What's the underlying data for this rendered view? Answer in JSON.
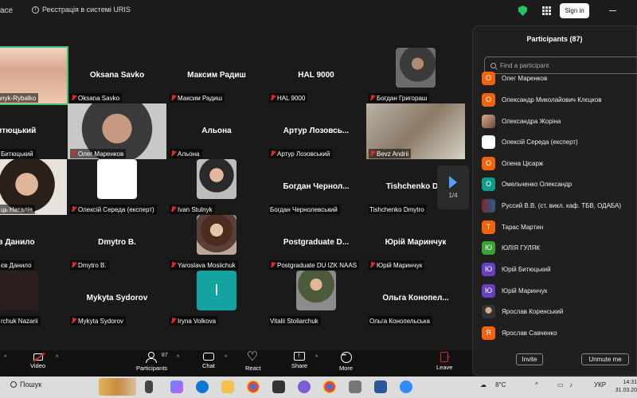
{
  "topbar": {
    "app_name": "ace",
    "registration": "Реєстрація в системі URIS",
    "sign_in": "Sign in"
  },
  "gallery": {
    "tiles": [
      {
        "name": "",
        "label": "a Kalashnyk-Rybalko"
      },
      {
        "name": "Oksana Savko",
        "label": "Oksana Savko"
      },
      {
        "name": "Максим Радиш",
        "label": "Максим Радиш"
      },
      {
        "name": "HAL 9000",
        "label": "HAL 9000"
      },
      {
        "name": "",
        "label": "Богдан Григораш"
      },
      {
        "name": "й Битюцький",
        "label": "Битюцький"
      },
      {
        "name": "",
        "label": "Олег Маренков"
      },
      {
        "name": "Альона",
        "label": "Альона"
      },
      {
        "name": "Артур Лозовсь...",
        "label": "Артур Лозовський"
      },
      {
        "name": "",
        "label": "Bevz Andrii"
      },
      {
        "name": "",
        "label": "ць Наталія"
      },
      {
        "name": "",
        "label": "Олексій Середа (експерт)"
      },
      {
        "name": "",
        "label": "Ivan Stulnyk"
      },
      {
        "name": "Богдан Чернол...",
        "label": "Богдан Чернолевський"
      },
      {
        "name": "Tishchenko Dm",
        "label": "Tishchenko Dmytro"
      },
      {
        "name": "едєв Данило",
        "label": "єв Данило"
      },
      {
        "name": "Dmytro B.",
        "label": "Dmytro B."
      },
      {
        "name": "",
        "label": "Yaroslava Mosiichuk"
      },
      {
        "name": "Postgraduate D...",
        "label": "Postgraduate DU IZK NAAS"
      },
      {
        "name": "Юрій Маринчук",
        "label": "Юрій Маринчук"
      },
      {
        "name": "",
        "label": "rchuk Nazarii"
      },
      {
        "name": "Mykyta Sydorov",
        "label": "Mykyta Sydorov"
      },
      {
        "name": "",
        "label": "Iryna Volkova"
      },
      {
        "name": "",
        "label": "Vitalii Stoliarchuk"
      },
      {
        "name": "Ольга Конопел...",
        "label": "Ольга Конопельська"
      }
    ],
    "page_indicator": "1/4",
    "teal_tile_letter": "I"
  },
  "participants": {
    "title": "Participants (87)",
    "search_placeholder": "Find a participant",
    "list": [
      {
        "initial": "О",
        "name": "Олег Маренков",
        "color": "#f2630c",
        "kind": "letter"
      },
      {
        "initial": "О",
        "name": "Олександр Миколайович Клєцков",
        "color": "#f2630c",
        "kind": "letter"
      },
      {
        "initial": "",
        "name": "Олександра Жоріна",
        "color": "#c08a70",
        "kind": "img"
      },
      {
        "initial": "",
        "name": "Олексій Середа (експерт)",
        "color": "#ffffff",
        "kind": "logo"
      },
      {
        "initial": "О",
        "name": "Олена Цісарж",
        "color": "#f2630c",
        "kind": "letter"
      },
      {
        "initial": "О",
        "name": "Омельченко Олександр",
        "color": "#109c8c",
        "kind": "letter"
      },
      {
        "initial": "",
        "name": "Руссий В.В. (ст. викл. каф. ТБВ, ОДАБА)",
        "color": "#7a2a2a",
        "kind": "flag"
      },
      {
        "initial": "Т",
        "name": "Тарас Мартин",
        "color": "#f2630c",
        "kind": "letter"
      },
      {
        "initial": "Ю",
        "name": "ЮЛІЯ ГУЛЯК",
        "color": "#3aa334",
        "kind": "letter"
      },
      {
        "initial": "Ю",
        "name": "Юрій Битюцький",
        "color": "#6a3fc1",
        "kind": "letter"
      },
      {
        "initial": "Ю",
        "name": "Юрій Маринчук",
        "color": "#6a3fc1",
        "kind": "letter"
      },
      {
        "initial": "",
        "name": "Ярослав Коренський",
        "color": "#555555",
        "kind": "photo"
      },
      {
        "initial": "Я",
        "name": "Ярослав Савченко",
        "color": "#f2630c",
        "kind": "letter"
      }
    ],
    "invite": "Invite",
    "unmute_me": "Unmute me"
  },
  "toolbar": {
    "video": "Video",
    "participants": "Participants",
    "participants_count": "87",
    "chat": "Chat",
    "react": "React",
    "share": "Share",
    "more": "More",
    "leave": "Leave",
    "leave_color": "#e02828"
  },
  "taskbar": {
    "search": "Пошук",
    "weather": "8°C",
    "language": "УКР",
    "time": "14:31",
    "date": "31.03.20"
  }
}
